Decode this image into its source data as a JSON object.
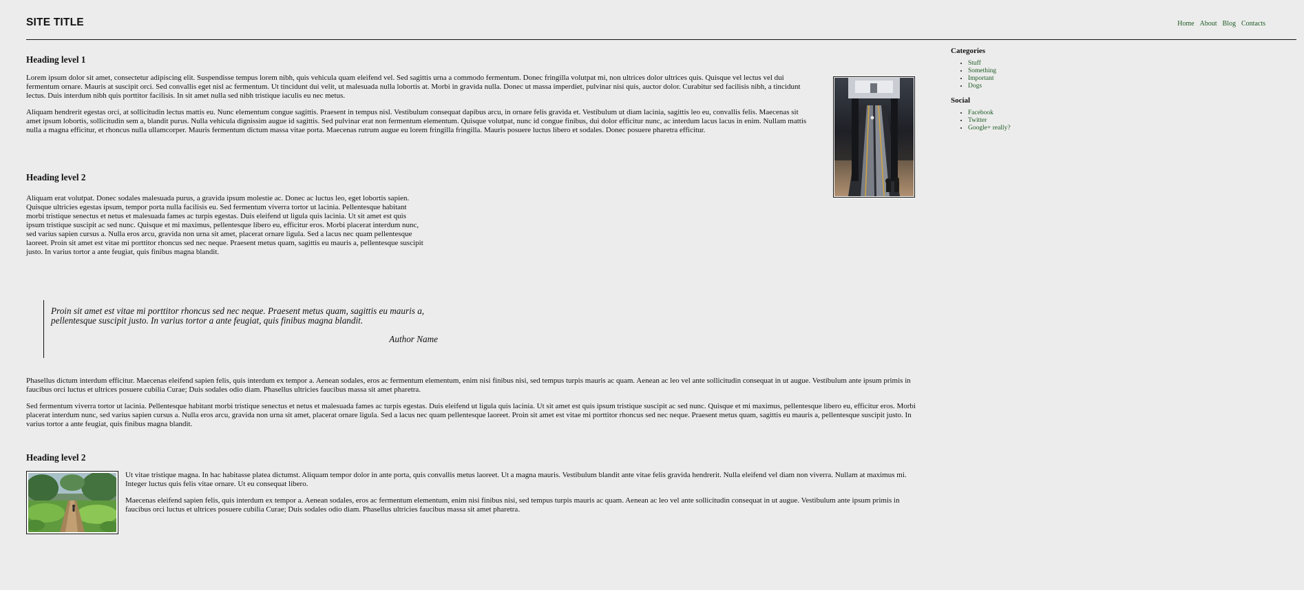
{
  "header": {
    "site_title": "SITE TITLE",
    "nav": [
      "Home",
      "About",
      "Blog",
      "Contacts"
    ]
  },
  "content": {
    "section1": {
      "heading": "Heading level 1",
      "p1": "Lorem ipsum dolor sit amet, consectetur adipiscing elit. Suspendisse tempus lorem nibh, quis vehicula quam eleifend vel. Sed sagittis urna a commodo fermentum. Donec fringilla volutpat mi, non ultrices dolor ultrices quis. Quisque vel lectus vel dui fermentum ornare. Mauris at suscipit orci. Sed convallis eget nisl ac fermentum. Ut tincidunt dui velit, ut malesuada nulla lobortis at. Morbi in gravida nulla. Donec ut massa imperdiet, pulvinar nisi quis, auctor dolor. Curabitur sed facilisis nibh, a tincidunt lectus. Duis interdum nibh quis porttitor facilisis. In sit amet nulla sed nibh tristique iaculis eu nec metus.",
      "p2": "Aliquam hendrerit egestas orci, at sollicitudin lectus mattis eu. Nunc elementum congue sagittis. Praesent in tempus nisl. Vestibulum consequat dapibus arcu, in ornare felis gravida et. Vestibulum ut diam lacinia, sagittis leo eu, convallis felis. Maecenas sit amet ipsum lobortis, sollicitudin sem a, blandit purus. Nulla vehicula dignissim augue id sagittis. Sed pulvinar erat non fermentum elementum. Quisque volutpat, nunc id congue finibus, dui dolor efficitur nunc, ac interdum lacus lacus in enim. Nullam mattis nulla a magna efficitur, et rhoncus nulla ullamcorper. Mauris fermentum dictum massa vitae porta. Maecenas rutrum augue eu lorem fringilla fringilla. Mauris posuere luctus libero et sodales. Donec posuere pharetra efficitur."
    },
    "section2": {
      "heading": "Heading level 2",
      "p1": "Aliquam erat volutpat. Donec sodales malesuada purus, a gravida ipsum molestie ac. Donec ac luctus leo, eget lobortis sapien. Quisque ultricies egestas ipsum, tempor porta nulla facilisis eu. Sed fermentum viverra tortor ut lacinia. Pellentesque habitant morbi tristique senectus et netus et malesuada fames ac turpis egestas. Duis eleifend ut ligula quis lacinia. Ut sit amet est quis ipsum tristique suscipit ac sed nunc. Quisque et mi maximus, pellentesque libero eu, efficitur eros. Morbi placerat interdum nunc, sed varius sapien cursus a. Nulla eros arcu, gravida non urna sit amet, placerat ornare ligula. Sed a lacus nec quam pellentesque laoreet. Proin sit amet est vitae mi porttitor rhoncus sed nec neque. Praesent metus quam, sagittis eu mauris a, pellentesque suscipit justo. In varius tortor a ante feugiat, quis finibus magna blandit.",
      "quote": "Proin sit amet est vitae mi porttitor rhoncus sed nec neque. Praesent metus quam, sagittis eu mauris a, pellentesque suscipit justo. In varius tortor a ante feugiat, quis finibus magna blandit.",
      "quote_author": "Author Name",
      "p2": "Phasellus dictum interdum efficitur. Maecenas eleifend sapien felis, quis interdum ex tempor a. Aenean sodales, eros ac fermentum elementum, enim nisi finibus nisi, sed tempus turpis mauris ac quam. Aenean ac leo vel ante sollicitudin consequat in ut augue. Vestibulum ante ipsum primis in faucibus orci luctus et ultrices posuere cubilia Curae; Duis sodales odio diam. Phasellus ultricies faucibus massa sit amet pharetra.",
      "p3": "Sed fermentum viverra tortor ut lacinia. Pellentesque habitant morbi tristique senectus et netus et malesuada fames ac turpis egestas. Duis eleifend ut ligula quis lacinia. Ut sit amet est quis ipsum tristique suscipit ac sed nunc. Quisque et mi maximus, pellentesque libero eu, efficitur eros. Morbi placerat interdum nunc, sed varius sapien cursus a. Nulla eros arcu, gravida non urna sit amet, placerat ornare ligula. Sed a lacus nec quam pellentesque laoreet. Proin sit amet est vitae mi porttitor rhoncus sed nec neque. Praesent metus quam, sagittis eu mauris a, pellentesque suscipit justo. In varius tortor a ante feugiat, quis finibus magna blandit."
    },
    "section3": {
      "heading": "Heading level 2",
      "p1": "Ut vitae tristique magna. In hac habitasse platea dictumst. Aliquam tempor dolor in ante porta, quis convallis metus laoreet. Ut a magna mauris. Vestibulum blandit ante vitae felis gravida hendrerit. Nulla eleifend vel diam non viverra. Nullam at maximus mi. Integer luctus quis felis vitae ornare. Ut eu consequat libero.",
      "p2": "Maecenas eleifend sapien felis, quis interdum ex tempor a. Aenean sodales, eros ac fermentum elementum, enim nisi finibus nisi, sed tempus turpis mauris ac quam. Aenean ac leo vel ante sollicitudin consequat in ut augue. Vestibulum ante ipsum primis in faucibus orci luctus et ultrices posuere cubilia Curae; Duis sodales odio diam. Phasellus ultricies faucibus massa sit amet pharetra."
    }
  },
  "sidebar": {
    "categories_heading": "Categories",
    "categories": [
      "Stuff",
      "Something",
      "Important",
      "Dogs"
    ],
    "social_heading": "Social",
    "social": [
      "Facebook",
      "Twitter",
      "Google+ really?"
    ]
  },
  "colors": {
    "background": "#ececec",
    "link": "#1c5a22",
    "text": "#111111"
  }
}
